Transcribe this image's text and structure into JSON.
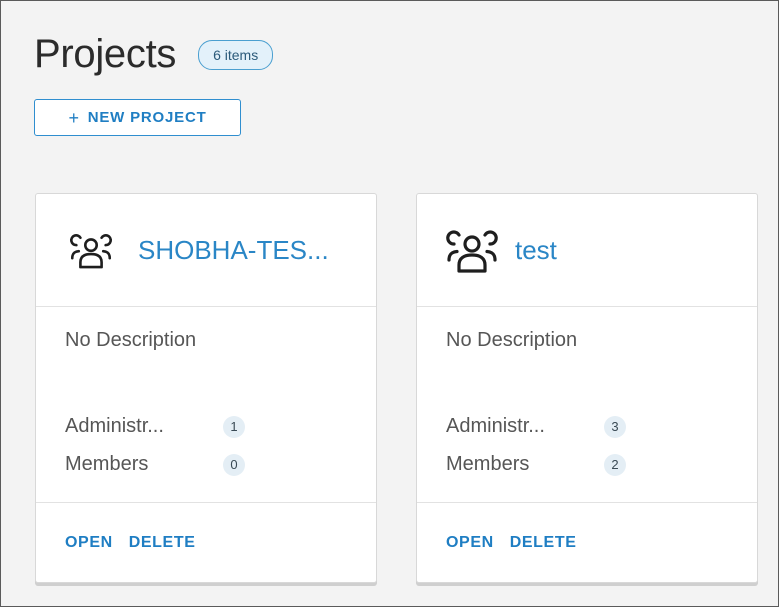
{
  "page": {
    "title": "Projects",
    "count_badge": "6 items"
  },
  "toolbar": {
    "new_project_icon": "+",
    "new_project_label": "NEW PROJECT"
  },
  "cards": [
    {
      "icon": "users-group-icon",
      "title": "SHOBHA-TES...",
      "description": "No Description",
      "admins_label": "Administr...",
      "admins_count": "1",
      "members_label": "Members",
      "members_count": "0",
      "open_label": "OPEN",
      "delete_label": "DELETE"
    },
    {
      "icon": "users-group-icon",
      "title": "test",
      "description": "No Description",
      "admins_label": "Administr...",
      "admins_count": "3",
      "members_label": "Members",
      "members_count": "2",
      "open_label": "OPEN",
      "delete_label": "DELETE"
    }
  ],
  "colors": {
    "accent": "#1f7ec3",
    "badge_border": "#4a9fd0",
    "page_bg": "#f3f3f3"
  }
}
